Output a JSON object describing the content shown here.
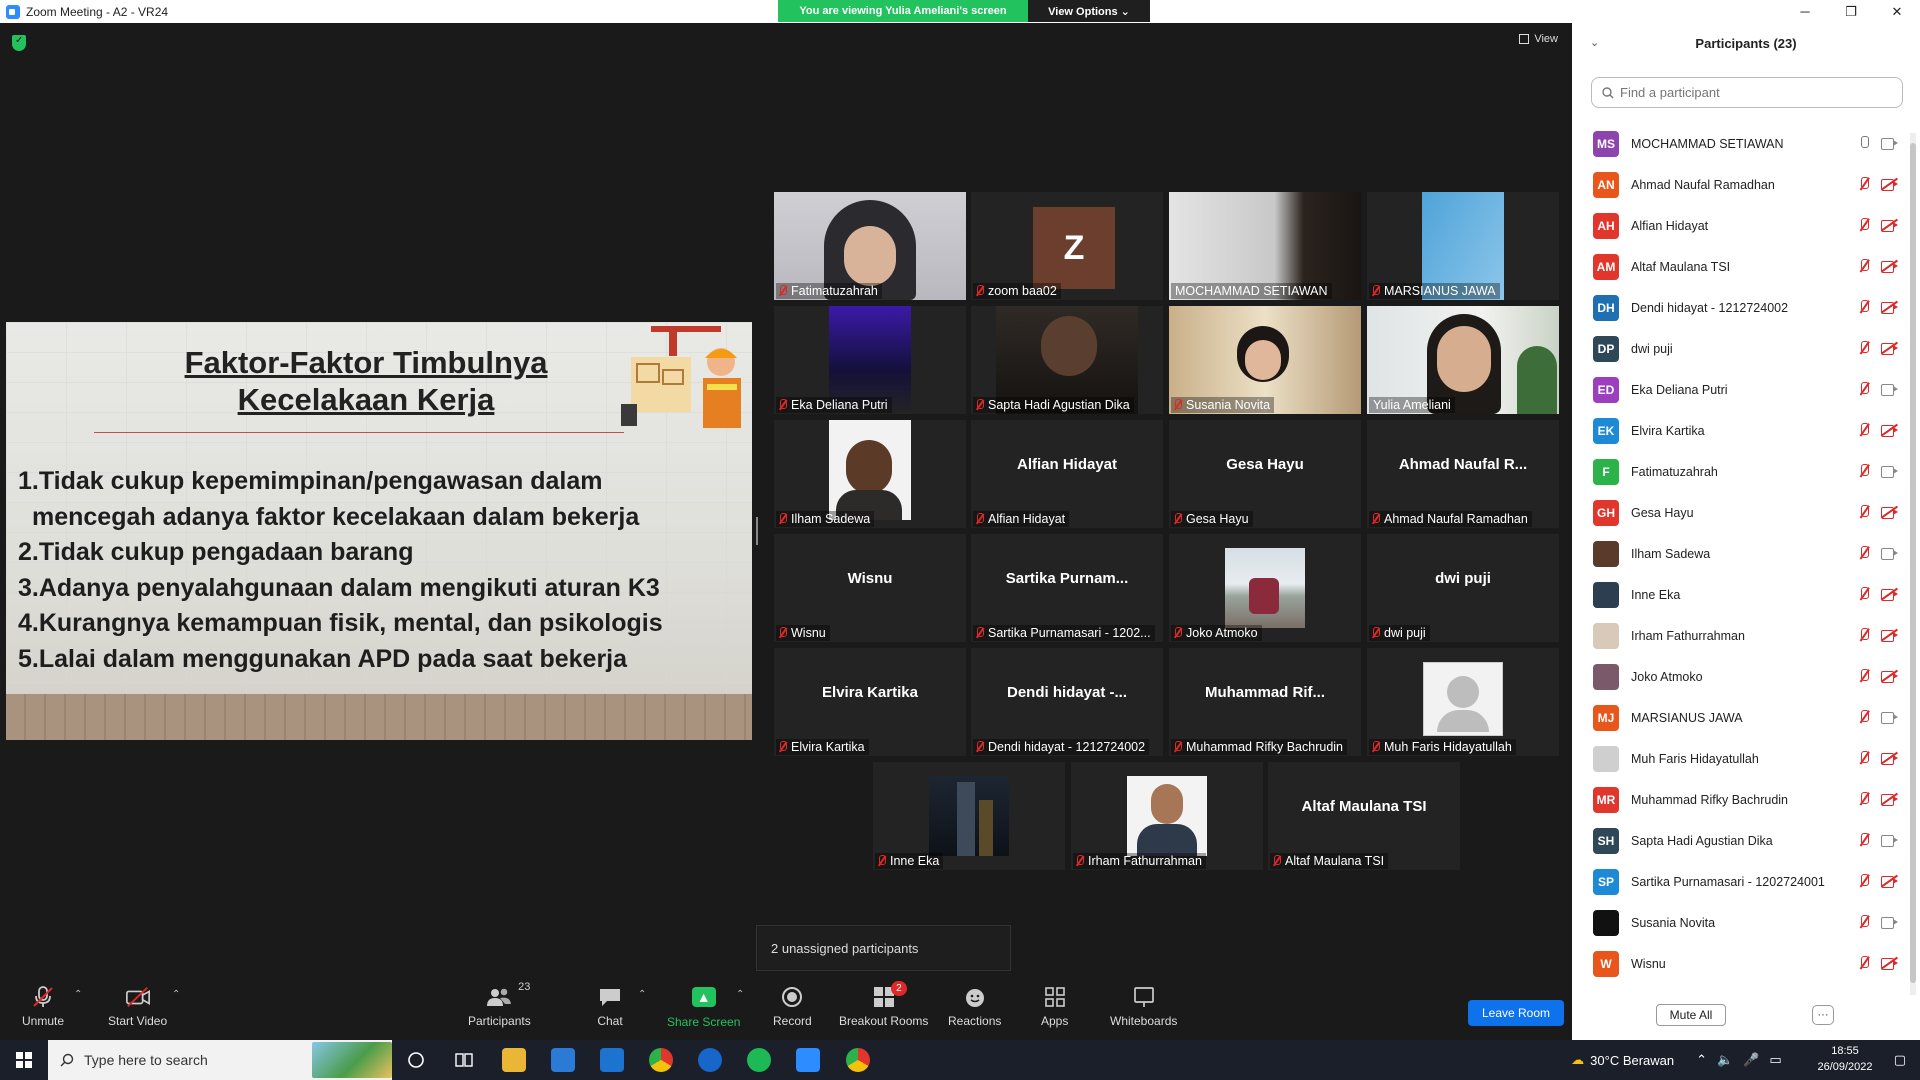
{
  "window": {
    "title": "Zoom Meeting - A2 - VR24",
    "minimize": "─",
    "maximize": "❐",
    "close": "✕"
  },
  "banner": {
    "viewing": "You are viewing Yulia Ameliani's screen",
    "view_options": "View Options ⌄"
  },
  "view_button": "View",
  "slide": {
    "title_line1": "Faktor-Faktor Timbulnya",
    "title_line2": "Kecelakaan Kerja",
    "points": [
      "1.Tidak cukup kepemimpinan/pengawasan dalam",
      "mencegah adanya faktor kecelakaan dalam bekerja",
      "2.Tidak cukup pengadaan barang",
      "3.Adanya penyalahgunaan dalam mengikuti aturan K3",
      "4.Kurangnya kemampuan fisik, mental, dan psikologis",
      "5.Lalai dalam menggunakan APD pada saat bekerja"
    ]
  },
  "tiles": {
    "t1": {
      "name": "Fatimatuzahrah"
    },
    "t2": {
      "name": "zoom baa02",
      "initial": "Z"
    },
    "t3": {
      "name": "MOCHAMMAD SETIAWAN"
    },
    "t4": {
      "name": "MARSIANUS JAWA"
    },
    "t5": {
      "name": "Eka Deliana Putri"
    },
    "t6": {
      "name": "Sapta Hadi Agustian Dika"
    },
    "t7": {
      "name": "Susania Novita"
    },
    "t8": {
      "name": "Yulia Ameliani"
    },
    "t9": {
      "name": "Ilham Sadewa"
    },
    "t10": {
      "name": "Alfian Hidayat",
      "center": "Alfian Hidayat"
    },
    "t11": {
      "name": "Gesa Hayu",
      "center": "Gesa Hayu"
    },
    "t12": {
      "name": "Ahmad Naufal Ramadhan",
      "center": "Ahmad Naufal R..."
    },
    "t13": {
      "name": "Wisnu",
      "center": "Wisnu"
    },
    "t14": {
      "name": "Sartika Purnamasari - 1202...",
      "center": "Sartika  Purnam..."
    },
    "t15": {
      "name": "Joko Atmoko"
    },
    "t16": {
      "name": "dwi puji",
      "center": "dwi puji"
    },
    "t17": {
      "name": "Elvira Kartika",
      "center": "Elvira Kartika"
    },
    "t18": {
      "name": "Dendi hidayat - 1212724002",
      "center": "Dendi  hidayat  -..."
    },
    "t19": {
      "name": "Muhammad Rifky Bachrudin",
      "center": "Muhammad  Rif..."
    },
    "t20": {
      "name": "Muh Faris Hidayatullah"
    },
    "t21": {
      "name": "Inne Eka"
    },
    "t22": {
      "name": "Irham Fathurrahman"
    },
    "t23": {
      "name": "Altaf Maulana TSI",
      "center": "Altaf Maulana TSI"
    }
  },
  "unassigned": "2 unassigned participants",
  "toolbar": {
    "unmute": "Unmute",
    "start_video": "Start Video",
    "participants": "Participants",
    "participants_count": "23",
    "chat": "Chat",
    "share_screen": "Share Screen",
    "record": "Record",
    "breakout_rooms": "Breakout Rooms",
    "breakout_badge": "2",
    "reactions": "Reactions",
    "apps": "Apps",
    "whiteboards": "Whiteboards",
    "leave_room": "Leave Room"
  },
  "panel": {
    "title": "Participants (23)",
    "search_placeholder": "Find a participant",
    "mute_all": "Mute All",
    "more": "···",
    "participants": [
      {
        "initials": "MS",
        "name": "MOCHAMMAD SETIAWAN",
        "color": "#8e44ad",
        "mic": "on",
        "cam": "on"
      },
      {
        "initials": "AN",
        "name": "Ahmad Naufal Ramadhan",
        "color": "#e8561c",
        "mic": "muted",
        "cam": "off"
      },
      {
        "initials": "AH",
        "name": "Alfian Hidayat",
        "color": "#e0362c",
        "mic": "muted",
        "cam": "off"
      },
      {
        "initials": "AM",
        "name": "Altaf Maulana TSI",
        "color": "#e0362c",
        "mic": "muted",
        "cam": "off"
      },
      {
        "initials": "DH",
        "name": "Dendi hidayat - 1212724002",
        "color": "#1f6fb3",
        "mic": "muted",
        "cam": "off"
      },
      {
        "initials": "DP",
        "name": "dwi puji",
        "color": "#2f4858",
        "mic": "muted",
        "cam": "off"
      },
      {
        "initials": "ED",
        "name": "Eka Deliana Putri",
        "color": "#9b3fbf",
        "mic": "muted",
        "cam": "on"
      },
      {
        "initials": "EK",
        "name": "Elvira Kartika",
        "color": "#1d8ad6",
        "mic": "muted",
        "cam": "off"
      },
      {
        "initials": "F",
        "name": "Fatimatuzahrah",
        "color": "#2bb34a",
        "mic": "muted",
        "cam": "on"
      },
      {
        "initials": "GH",
        "name": "Gesa Hayu",
        "color": "#e0362c",
        "mic": "muted",
        "cam": "off"
      },
      {
        "initials": "",
        "name": "Ilham Sadewa",
        "color": "#5a3a2a",
        "mic": "muted",
        "cam": "on"
      },
      {
        "initials": "",
        "name": "Inne Eka",
        "color": "#2c3e50",
        "mic": "muted",
        "cam": "off"
      },
      {
        "initials": "",
        "name": "Irham Fathurrahman",
        "color": "#d8c9b8",
        "mic": "muted",
        "cam": "off"
      },
      {
        "initials": "",
        "name": "Joko Atmoko",
        "color": "#7a5a6a",
        "mic": "muted",
        "cam": "off"
      },
      {
        "initials": "MJ",
        "name": "MARSIANUS JAWA",
        "color": "#e8561c",
        "mic": "muted",
        "cam": "on"
      },
      {
        "initials": "",
        "name": "Muh Faris Hidayatullah",
        "color": "#cfcfcf",
        "mic": "muted",
        "cam": "off"
      },
      {
        "initials": "MR",
        "name": "Muhammad Rifky Bachrudin",
        "color": "#e0362c",
        "mic": "muted",
        "cam": "off"
      },
      {
        "initials": "SH",
        "name": "Sapta Hadi Agustian Dika",
        "color": "#2f4858",
        "mic": "muted",
        "cam": "on"
      },
      {
        "initials": "SP",
        "name": "Sartika Purnamasari - 1202724001",
        "color": "#1d8ad6",
        "mic": "muted",
        "cam": "off"
      },
      {
        "initials": "",
        "name": "Susania Novita",
        "color": "#111111",
        "mic": "muted",
        "cam": "on"
      },
      {
        "initials": "W",
        "name": "Wisnu",
        "color": "#e8561c",
        "mic": "muted",
        "cam": "off"
      }
    ]
  },
  "taskbar": {
    "search_placeholder": "Type here to search",
    "weather": "30°C  Berawan",
    "time": "18:55",
    "date": "26/09/2022"
  }
}
